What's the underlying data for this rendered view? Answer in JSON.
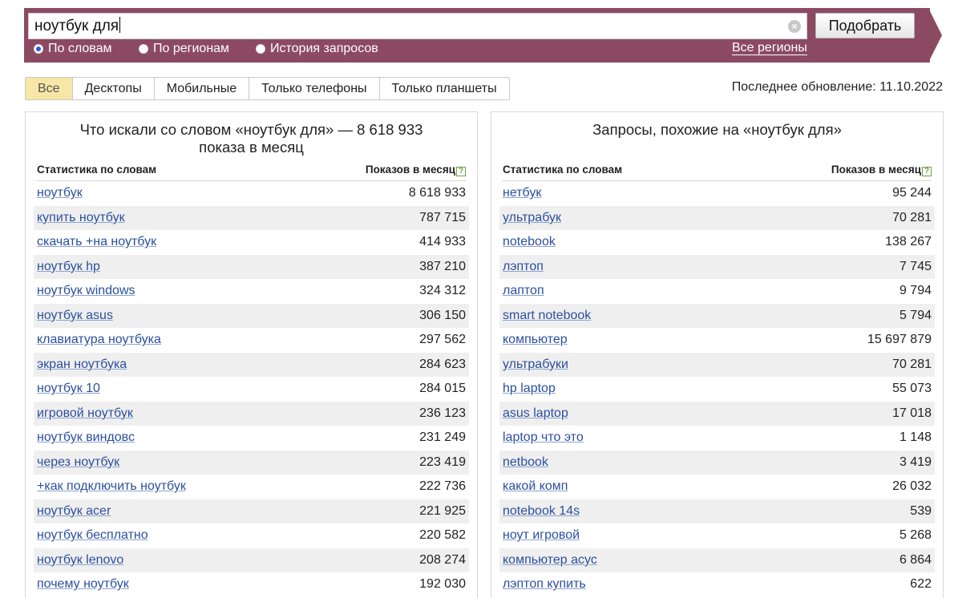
{
  "search": {
    "query": "ноутбук для",
    "submit_label": "Подобрать",
    "modes": [
      {
        "label": "По словам",
        "checked": true
      },
      {
        "label": "По регионам",
        "checked": false
      },
      {
        "label": "История запросов",
        "checked": false
      }
    ],
    "regions_link": "Все регионы"
  },
  "device_tabs": [
    {
      "label": "Все",
      "active": true
    },
    {
      "label": "Десктопы",
      "active": false
    },
    {
      "label": "Мобильные",
      "active": false
    },
    {
      "label": "Только телефоны",
      "active": false
    },
    {
      "label": "Только планшеты",
      "active": false
    }
  ],
  "last_update": "Последнее обновление: 11.10.2022",
  "left_panel": {
    "title_line1": "Что искали со словом «ноутбук для» — 8 618 933",
    "title_line2": "показа в месяц",
    "col_word": "Статистика по словам",
    "col_count": "Показов в месяц",
    "rows": [
      {
        "kw": "ноутбук",
        "count": "8 618 933"
      },
      {
        "kw": "купить ноутбук",
        "count": "787 715"
      },
      {
        "kw": "скачать +на ноутбук",
        "count": "414 933"
      },
      {
        "kw": "ноутбук hp",
        "count": "387 210"
      },
      {
        "kw": "ноутбук windows",
        "count": "324 312"
      },
      {
        "kw": "ноутбук asus",
        "count": "306 150"
      },
      {
        "kw": "клавиатура ноутбука",
        "count": "297 562"
      },
      {
        "kw": "экран ноутбука",
        "count": "284 623"
      },
      {
        "kw": "ноутбук 10",
        "count": "284 015"
      },
      {
        "kw": "игровой ноутбук",
        "count": "236 123"
      },
      {
        "kw": "ноутбук виндовс",
        "count": "231 249"
      },
      {
        "kw": "через ноутбук",
        "count": "223 419"
      },
      {
        "kw": "+как подключить ноутбук",
        "count": "222 736"
      },
      {
        "kw": "ноутбук acer",
        "count": "221 925"
      },
      {
        "kw": "ноутбук бесплатно",
        "count": "220 582"
      },
      {
        "kw": "ноутбук lenovo",
        "count": "208 274"
      },
      {
        "kw": "почему ноутбук",
        "count": "192 030"
      }
    ]
  },
  "right_panel": {
    "title_line1": "Запросы, похожие на «ноутбук для»",
    "col_word": "Статистика по словам",
    "col_count": "Показов в месяц",
    "rows": [
      {
        "kw": "нетбук",
        "count": "95 244"
      },
      {
        "kw": "ультрабук",
        "count": "70 281"
      },
      {
        "kw": "notebook",
        "count": "138 267"
      },
      {
        "kw": "лэптоп",
        "count": "7 745"
      },
      {
        "kw": "лаптоп",
        "count": "9 794"
      },
      {
        "kw": "smart notebook",
        "count": "5 794"
      },
      {
        "kw": "компьютер",
        "count": "15 697 879"
      },
      {
        "kw": "ультрабуки",
        "count": "70 281"
      },
      {
        "kw": "hp laptop",
        "count": "55 073"
      },
      {
        "kw": "asus laptop",
        "count": "17 018"
      },
      {
        "kw": "laptop что это",
        "count": "1 148"
      },
      {
        "kw": "netbook",
        "count": "3 419"
      },
      {
        "kw": "какой комп",
        "count": "26 032"
      },
      {
        "kw": "notebook 14s",
        "count": "539"
      },
      {
        "kw": "ноут игровой",
        "count": "5 268"
      },
      {
        "kw": "компьютер асус",
        "count": "6 864"
      },
      {
        "kw": "лэптоп купить",
        "count": "622"
      }
    ]
  },
  "colors": {
    "band": "#8c4a62",
    "link": "#2b4f9e",
    "active_tab": "#f7e6a6",
    "row_stripe": "#efefef"
  }
}
